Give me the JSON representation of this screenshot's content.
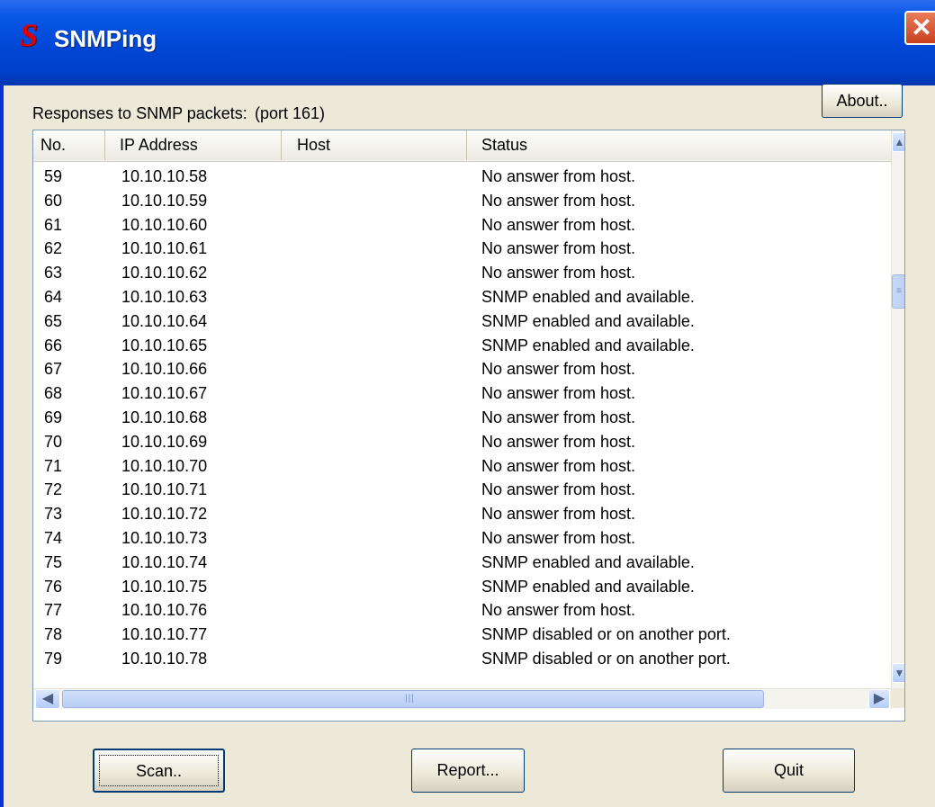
{
  "window": {
    "title": "SNMPing",
    "app_icon_letter": "S",
    "close_glyph": "✕"
  },
  "main": {
    "responses_label": "Responses to SNMP packets:",
    "port_label": "(port 161)",
    "about_label": "About.."
  },
  "table": {
    "columns": [
      "No.",
      "IP Address",
      "Host",
      "Status"
    ],
    "rows": [
      {
        "no": "59",
        "ip": "10.10.10.58",
        "host": "",
        "status": "No answer from host."
      },
      {
        "no": "60",
        "ip": "10.10.10.59",
        "host": "",
        "status": "No answer from host."
      },
      {
        "no": "61",
        "ip": "10.10.10.60",
        "host": "",
        "status": "No answer from host."
      },
      {
        "no": "62",
        "ip": "10.10.10.61",
        "host": "",
        "status": "No answer from host."
      },
      {
        "no": "63",
        "ip": "10.10.10.62",
        "host": "",
        "status": "No answer from host."
      },
      {
        "no": "64",
        "ip": "10.10.10.63",
        "host": "",
        "status": "SNMP enabled and available."
      },
      {
        "no": "65",
        "ip": "10.10.10.64",
        "host": "",
        "status": "SNMP enabled and available."
      },
      {
        "no": "66",
        "ip": "10.10.10.65",
        "host": "",
        "status": "SNMP enabled and available."
      },
      {
        "no": "67",
        "ip": "10.10.10.66",
        "host": "",
        "status": "No answer from host."
      },
      {
        "no": "68",
        "ip": "10.10.10.67",
        "host": "",
        "status": "No answer from host."
      },
      {
        "no": "69",
        "ip": "10.10.10.68",
        "host": "",
        "status": "No answer from host."
      },
      {
        "no": "70",
        "ip": "10.10.10.69",
        "host": "",
        "status": "No answer from host."
      },
      {
        "no": "71",
        "ip": "10.10.10.70",
        "host": "",
        "status": "No answer from host."
      },
      {
        "no": "72",
        "ip": "10.10.10.71",
        "host": "",
        "status": "No answer from host."
      },
      {
        "no": "73",
        "ip": "10.10.10.72",
        "host": "",
        "status": "No answer from host."
      },
      {
        "no": "74",
        "ip": "10.10.10.73",
        "host": "",
        "status": "No answer from host."
      },
      {
        "no": "75",
        "ip": "10.10.10.74",
        "host": "",
        "status": "SNMP enabled and available."
      },
      {
        "no": "76",
        "ip": "10.10.10.75",
        "host": "",
        "status": "SNMP enabled and available."
      },
      {
        "no": "77",
        "ip": "10.10.10.76",
        "host": "",
        "status": "No answer from host."
      },
      {
        "no": "78",
        "ip": "10.10.10.77",
        "host": "",
        "status": "SNMP disabled or on another port."
      },
      {
        "no": "79",
        "ip": "10.10.10.78",
        "host": "",
        "status": "SNMP disabled or on another port."
      }
    ]
  },
  "scrollbars": {
    "up_glyph": "▲",
    "down_glyph": "▼",
    "left_glyph": "◀",
    "right_glyph": "▶"
  },
  "buttons": {
    "scan_label": "Scan..",
    "report_label": "Report...",
    "quit_label": "Quit"
  },
  "colors": {
    "titlebar": "#0047d6",
    "app_icon": "#e00000",
    "close_button": "#c9401e",
    "window_face": "#ece9d8"
  },
  "icons": {
    "app": "snmping-app-icon",
    "close": "close-icon"
  }
}
